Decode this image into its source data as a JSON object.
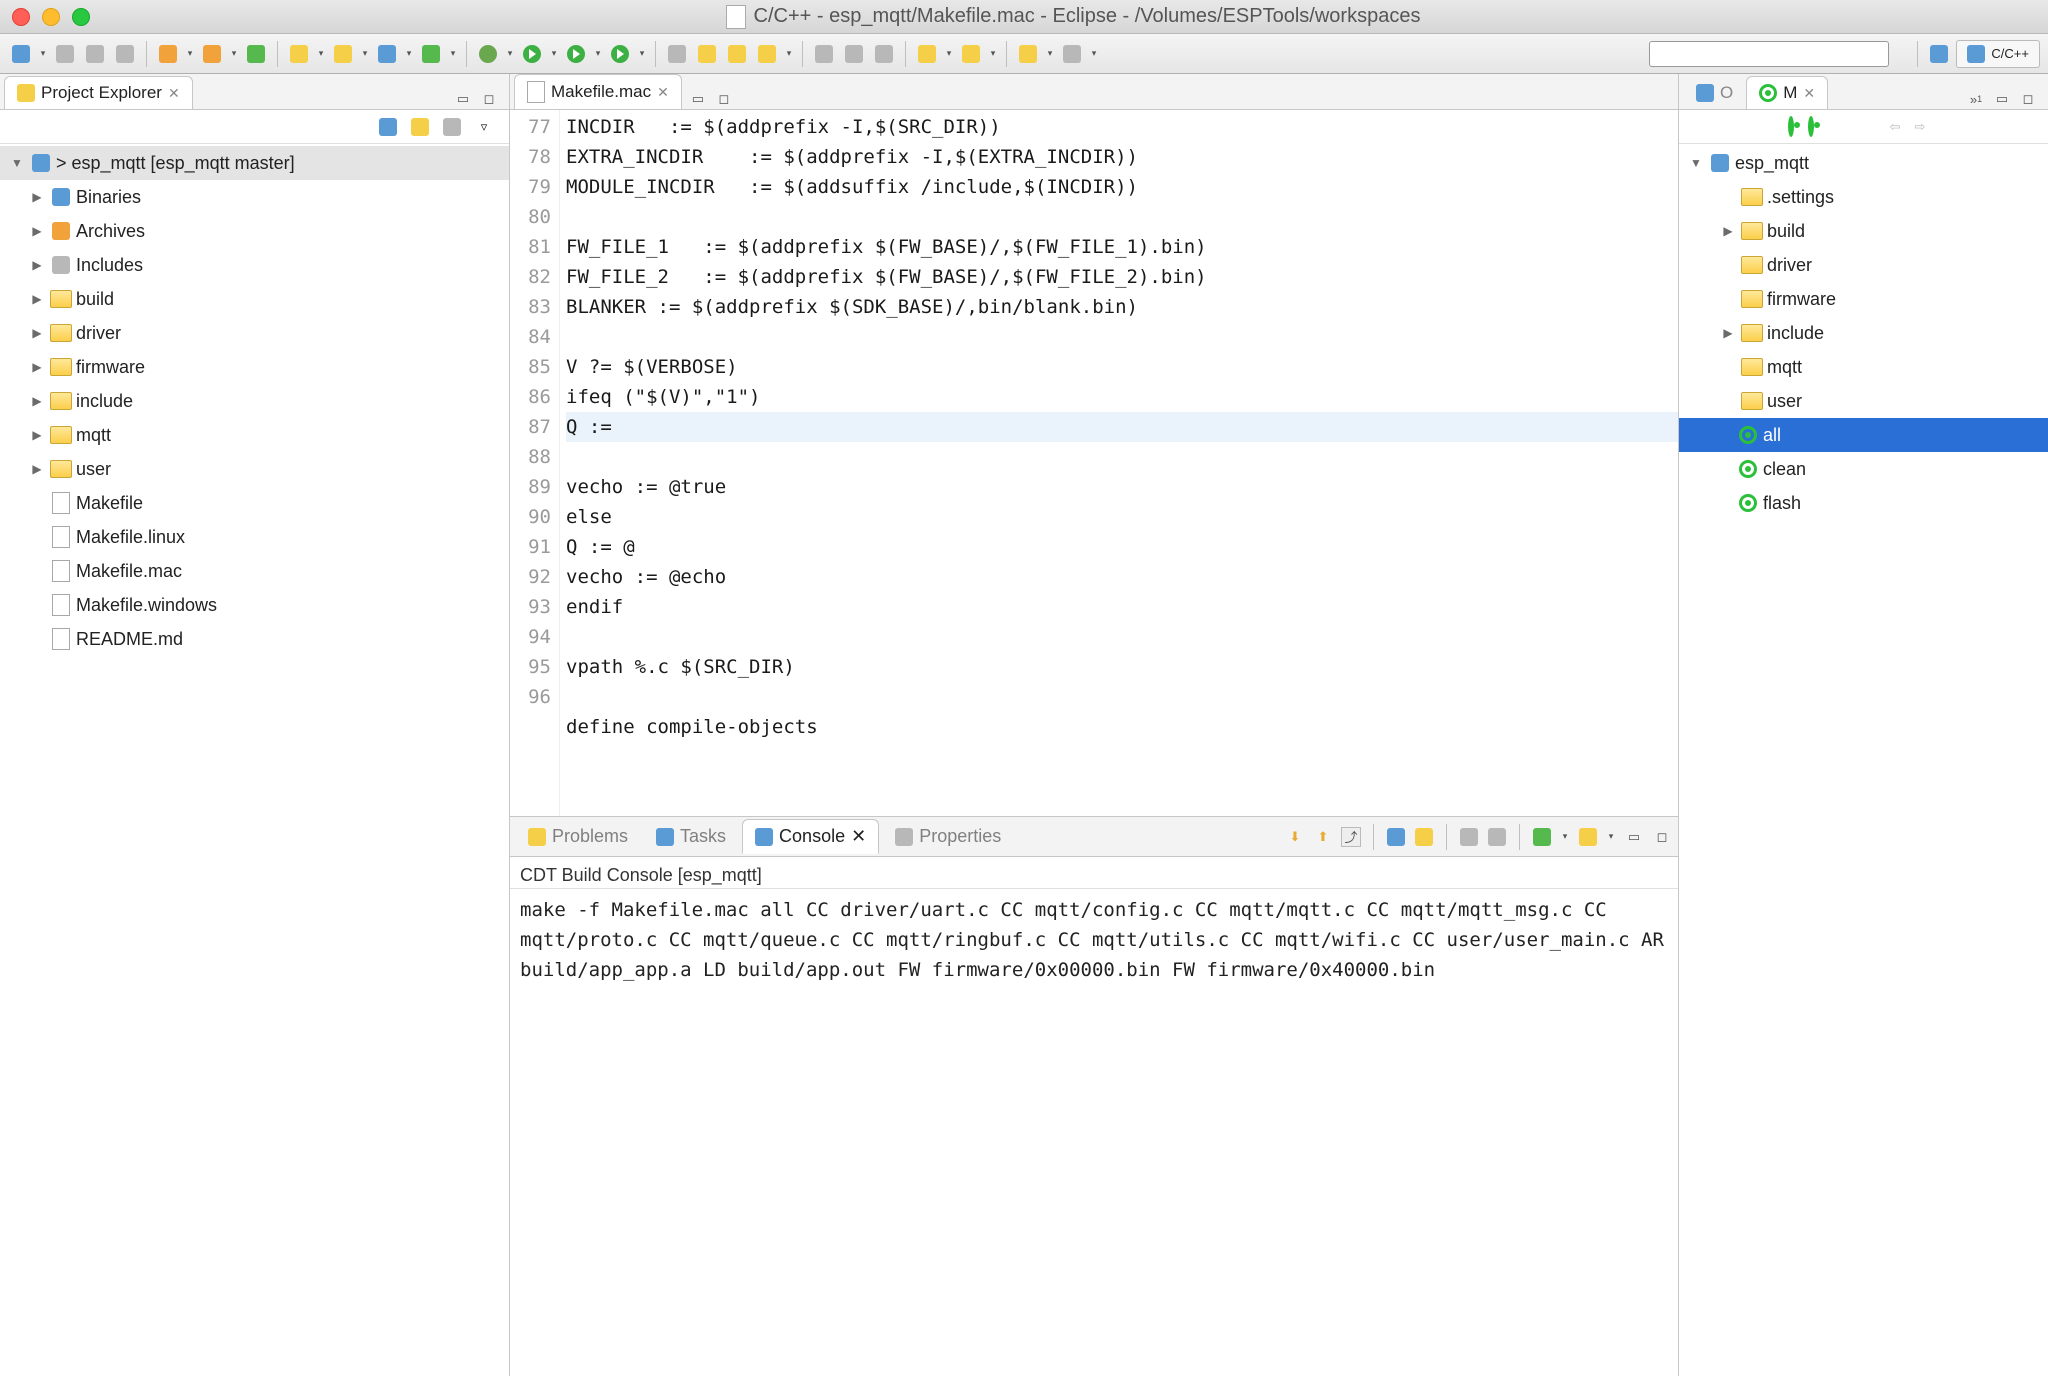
{
  "window": {
    "title": "C/C++ - esp_mqtt/Makefile.mac - Eclipse - /Volumes/ESPTools/workspaces"
  },
  "perspective": {
    "label": "C/C++"
  },
  "projectExplorer": {
    "title": "Project Explorer",
    "root": "> esp_mqtt  [esp_mqtt master]",
    "items": [
      {
        "label": "Binaries",
        "icon": "binaries"
      },
      {
        "label": "Archives",
        "icon": "archives"
      },
      {
        "label": "Includes",
        "icon": "includes"
      },
      {
        "label": "build",
        "icon": "folder"
      },
      {
        "label": "driver",
        "icon": "folder"
      },
      {
        "label": "firmware",
        "icon": "folder"
      },
      {
        "label": "include",
        "icon": "folder"
      },
      {
        "label": "mqtt",
        "icon": "folder"
      },
      {
        "label": "user",
        "icon": "folder"
      },
      {
        "label": "Makefile",
        "icon": "file"
      },
      {
        "label": "Makefile.linux",
        "icon": "file"
      },
      {
        "label": "Makefile.mac",
        "icon": "file"
      },
      {
        "label": "Makefile.windows",
        "icon": "file"
      },
      {
        "label": "README.md",
        "icon": "file"
      }
    ]
  },
  "editor": {
    "tab": "Makefile.mac",
    "startLine": 77,
    "lines": [
      "INCDIR   := $(addprefix -I,$(SRC_DIR))",
      "EXTRA_INCDIR    := $(addprefix -I,$(EXTRA_INCDIR))",
      "MODULE_INCDIR   := $(addsuffix /include,$(INCDIR))",
      "",
      "FW_FILE_1   := $(addprefix $(FW_BASE)/,$(FW_FILE_1).bin)",
      "FW_FILE_2   := $(addprefix $(FW_BASE)/,$(FW_FILE_2).bin)",
      "BLANKER := $(addprefix $(SDK_BASE)/,bin/blank.bin)",
      "",
      "V ?= $(VERBOSE)",
      "ifeq (\"$(V)\",\"1\")",
      "Q :=",
      "vecho := @true",
      "else",
      "Q := @",
      "vecho := @echo",
      "endif",
      "",
      "vpath %.c $(SRC_DIR)",
      "",
      "define compile-objects"
    ],
    "highlightIndex": 10
  },
  "bottomTabs": {
    "tabs": [
      "Problems",
      "Tasks",
      "Console",
      "Properties"
    ],
    "active": "Console"
  },
  "console": {
    "title": "CDT Build Console [esp_mqtt]",
    "lines": [
      "make -f Makefile.mac all",
      "CC driver/uart.c",
      "CC mqtt/config.c",
      "CC mqtt/mqtt.c",
      "CC mqtt/mqtt_msg.c",
      "CC mqtt/proto.c",
      "CC mqtt/queue.c",
      "CC mqtt/ringbuf.c",
      "CC mqtt/utils.c",
      "CC mqtt/wifi.c",
      "CC user/user_main.c",
      "AR build/app_app.a",
      "LD build/app.out",
      "FW firmware/0x00000.bin",
      "FW firmware/0x40000.bin"
    ]
  },
  "rightTabs": {
    "outline": "O",
    "maketargets": "M"
  },
  "outline": {
    "project": "esp_mqtt",
    "folders": [
      {
        "label": ".settings",
        "expandable": false
      },
      {
        "label": "build",
        "expandable": true
      },
      {
        "label": "driver",
        "expandable": false
      },
      {
        "label": "firmware",
        "expandable": false
      },
      {
        "label": "include",
        "expandable": true
      },
      {
        "label": "mqtt",
        "expandable": false
      },
      {
        "label": "user",
        "expandable": false
      }
    ],
    "targets": [
      {
        "label": "all",
        "selected": true
      },
      {
        "label": "clean",
        "selected": false
      },
      {
        "label": "flash",
        "selected": false
      }
    ]
  }
}
